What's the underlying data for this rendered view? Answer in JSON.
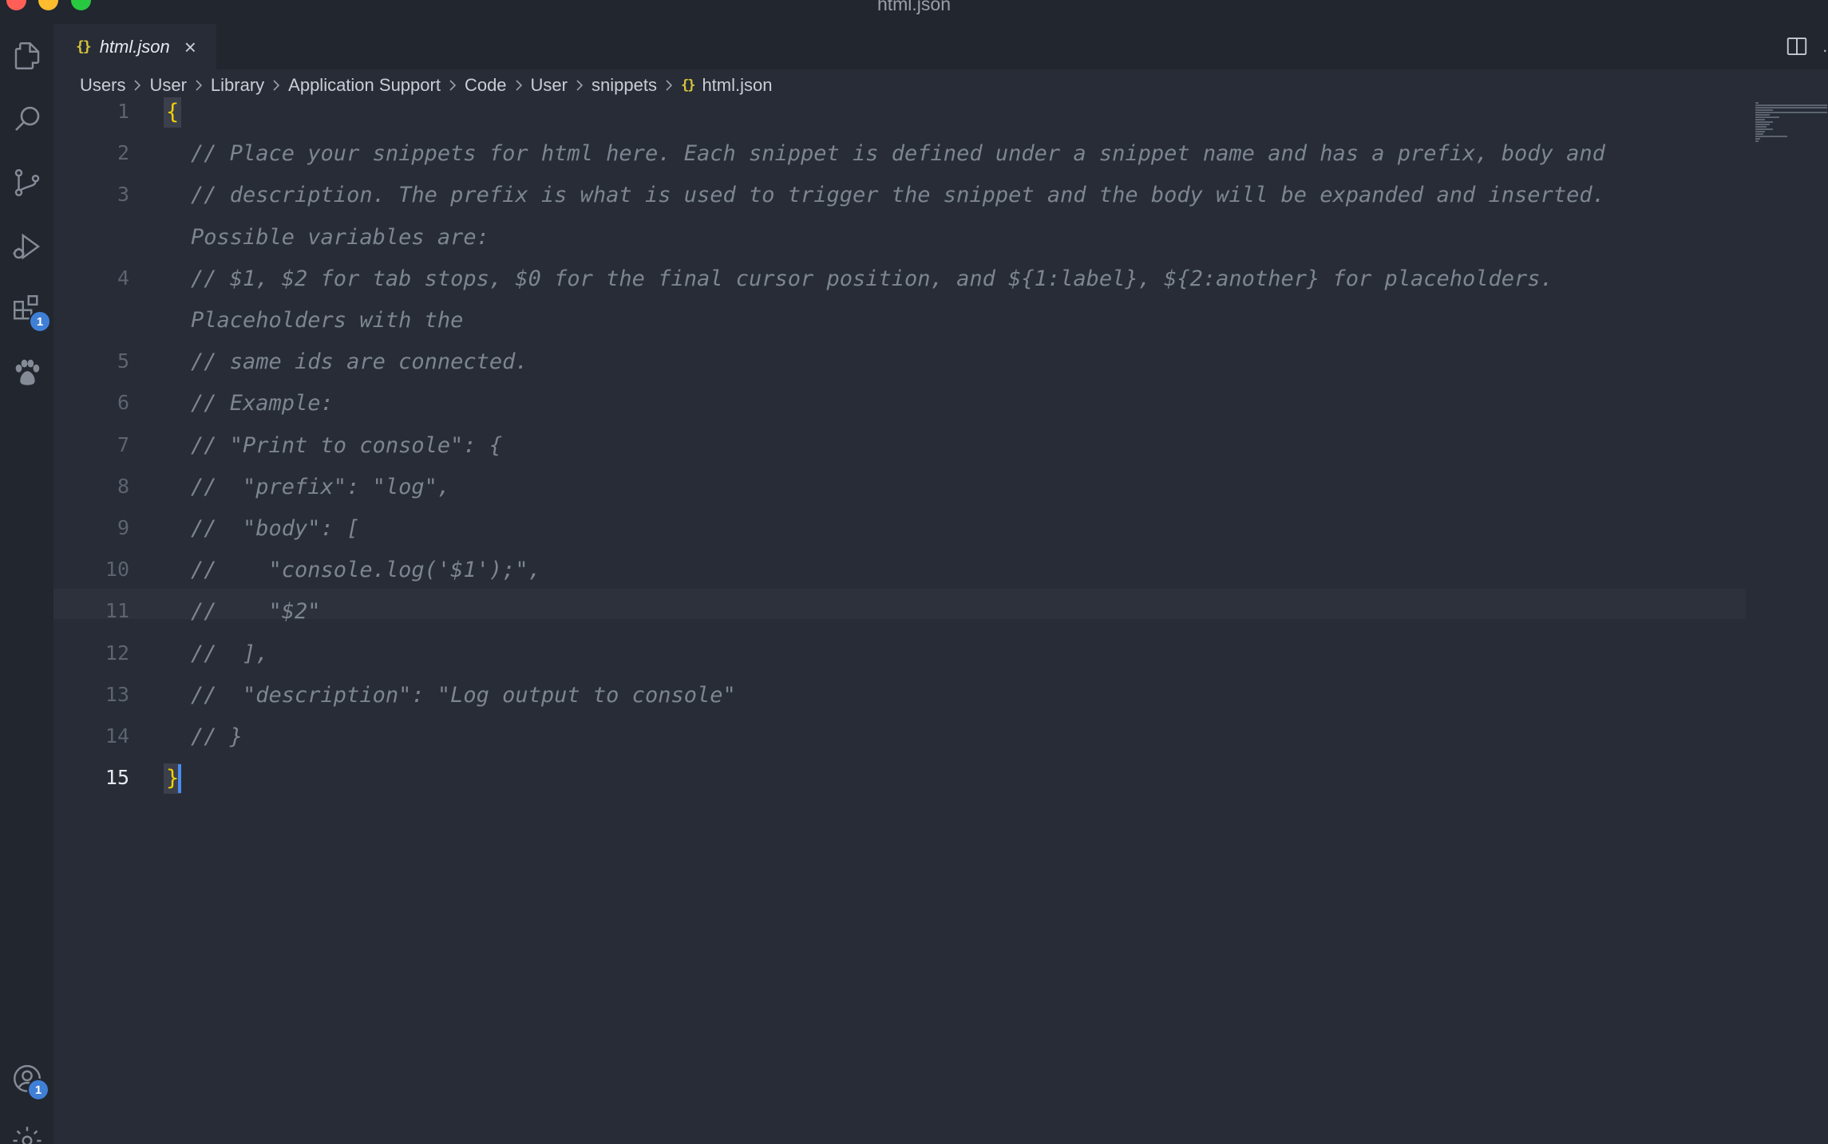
{
  "window": {
    "title": "html.json"
  },
  "activity_bar": {
    "items": [
      "explorer-icon",
      "search-icon",
      "source-control-icon",
      "run-debug-icon",
      "extensions-icon",
      "paw-icon"
    ],
    "extensions_badge": "1",
    "accounts_badge": "1",
    "bottom_items": [
      "accounts-icon",
      "gear-icon"
    ]
  },
  "tab": {
    "icon": "{}",
    "label": "html.json",
    "close": "×"
  },
  "breadcrumb": {
    "segments": [
      "Users",
      "User",
      "Library",
      "Application Support",
      "Code",
      "User",
      "snippets"
    ],
    "file_icon": "{}",
    "file": "html.json"
  },
  "editor": {
    "line_numbers": [
      "1",
      "2",
      "3",
      "4",
      "5",
      "6",
      "7",
      "8",
      "9",
      "10",
      "11",
      "12",
      "13",
      "14",
      "15"
    ],
    "open_brace": "{",
    "close_brace": "}",
    "lines": [
      "// Place your snippets for html here. Each snippet is defined under a snippet name and has a prefix, body and",
      "// description. The prefix is what is used to trigger the snippet and the body will be expanded and inserted.",
      "Possible variables are:",
      "// $1, $2 for tab stops, $0 for the final cursor position, and ${1:label}, ${2:another} for placeholders.",
      "Placeholders with the",
      "// same ids are connected.",
      "// Example:",
      "// \"Print to console\": {",
      "//  \"prefix\": \"log\",",
      "//  \"body\": [",
      "//    \"console.log('$1');\",",
      "//    \"$2\"",
      "//  ],",
      "//  \"description\": \"Log output to console\"",
      "// }"
    ]
  },
  "colors": {
    "background": "#272c36",
    "sidebar": "#22262f",
    "comment": "#7d8590",
    "brace": "#f1d000",
    "badge": "#3f7fd6",
    "cursor": "#4a8cf0"
  }
}
